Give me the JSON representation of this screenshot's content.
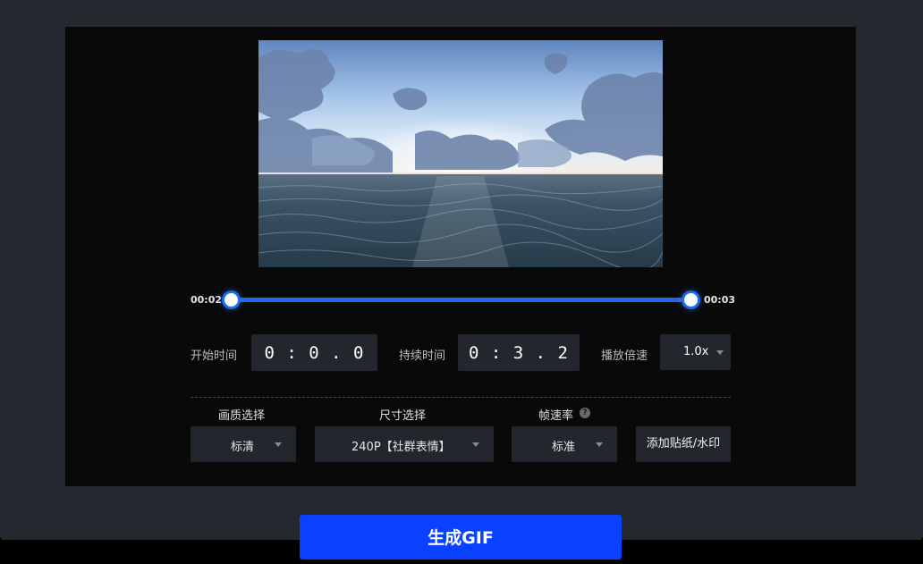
{
  "video": {
    "description_icon": "ocean-sunset-video-frame"
  },
  "trim": {
    "start_label": "00:02",
    "end_label": "00:03"
  },
  "controls": {
    "start_time_label": "开始时间",
    "start_time_value": "0 : 0 . 0",
    "duration_label": "持续时间",
    "duration_value": "0 : 3 . 2",
    "speed_label": "播放倍速",
    "speed_value": "1.0x"
  },
  "options": {
    "quality_label": "画质选择",
    "quality_value": "标清",
    "size_label": "尺寸选择",
    "size_value": "240P【社群表情】",
    "fps_label": "帧速率",
    "fps_value": "标准",
    "help_glyph": "?",
    "sticker_button": "添加贴纸/水印"
  },
  "generate_button": "生成GIF",
  "colors": {
    "accent": "#1a6cf0",
    "generate": "#0a41ff",
    "panel": "#090909",
    "frame": "#262830"
  }
}
